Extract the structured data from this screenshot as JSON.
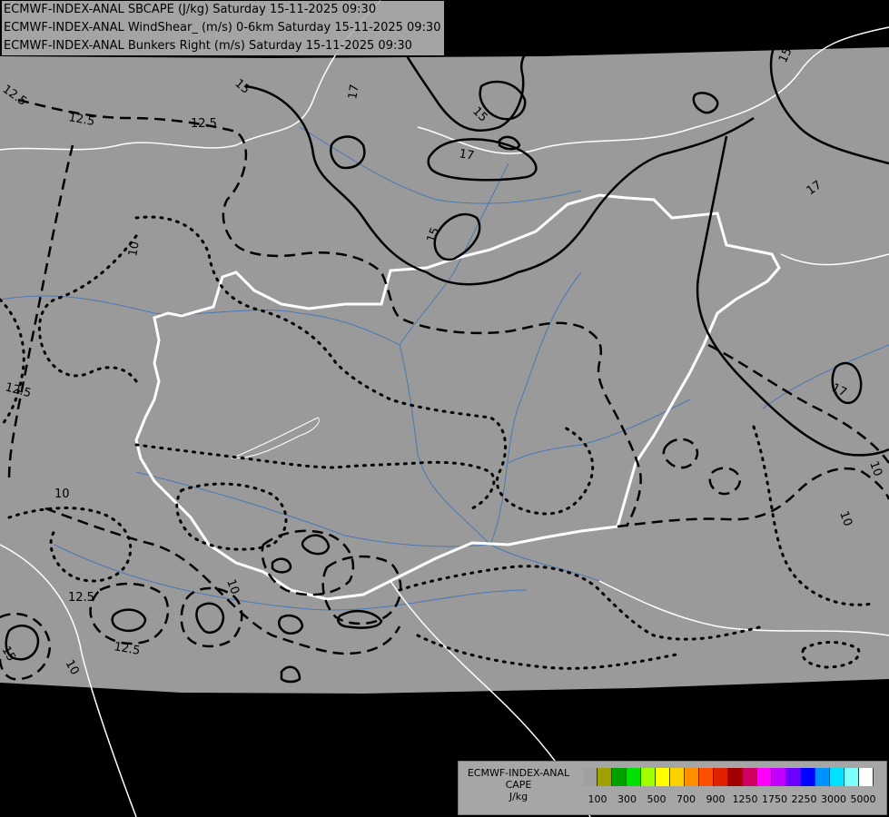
{
  "titles": [
    "ECMWF-INDEX-ANAL SBCAPE (J/kg) Saturday 15-11-2025 09:30",
    "ECMWF-INDEX-ANAL WindShear_ (m/s) 0-6km Saturday 15-11-2025 09:30",
    "ECMWF-INDEX-ANAL Bunkers Right (m/s) Saturday 15-11-2025 09:30"
  ],
  "legend": {
    "line1": "ECMWF-INDEX-ANAL",
    "line2": "CAPE",
    "line3": "J/kg",
    "colors": [
      "#a0a0a0",
      "#a0a000",
      "#00a000",
      "#00e000",
      "#a0ff00",
      "#ffff00",
      "#ffd000",
      "#ff9000",
      "#ff5000",
      "#e02000",
      "#a00000",
      "#d00060",
      "#ff00ff",
      "#c000ff",
      "#7000ff",
      "#0000ff",
      "#0090ff",
      "#00e0ff",
      "#80ffff",
      "#ffffff"
    ],
    "ticks": [
      "100",
      "300",
      "500",
      "700",
      "900",
      "1250",
      "1750",
      "2250",
      "3000",
      "5000"
    ]
  },
  "contour_labels": {
    "l1": "15",
    "l2": "12.5",
    "l3": "12.5",
    "l4": "12.5",
    "l5": "17",
    "l6": "15",
    "l7": "17",
    "l8": "15",
    "l9": "15",
    "l10": "17",
    "l11": "10",
    "l12": "12.5",
    "l13": "17",
    "l14": "10",
    "l15": "10",
    "l16": "10",
    "l17": "12.5",
    "l18": "12.5",
    "l19": "10",
    "l20": "15"
  },
  "colors": {
    "domain": "#9a9a9a",
    "outside": "#000000",
    "borders": "#ffffff",
    "rivers": "#4a78b8",
    "contours": "#000000"
  }
}
